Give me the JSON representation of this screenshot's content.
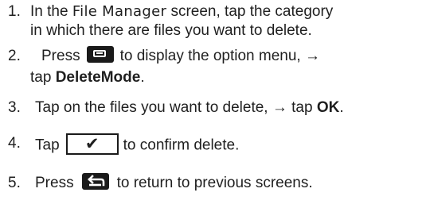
{
  "steps": [
    {
      "num": "1.",
      "line1_a": "In the ",
      "line1_app": "File Manager",
      "line1_b": " screen, tap the category",
      "line2": "in which there are files you want to delete."
    },
    {
      "num": "2.",
      "line1_a": "Press",
      "line1_icon": "menu-key-icon",
      "line1_b": "to display the option menu, →",
      "line2_a": "tap ",
      "line2_bold": "DeleteMode",
      "line2_b": "."
    },
    {
      "num": "3.",
      "text_a": "Tap on the files you want to delete, → tap ",
      "text_bold": "OK",
      "text_b": "."
    },
    {
      "num": "4.",
      "text_a": "Tap",
      "icon": "checkmark-button-icon",
      "check_glyph": "✔",
      "text_b": "to confirm delete."
    },
    {
      "num": "5.",
      "text_a": "Press",
      "icon": "back-key-icon",
      "text_b": "to return to previous screens."
    }
  ]
}
